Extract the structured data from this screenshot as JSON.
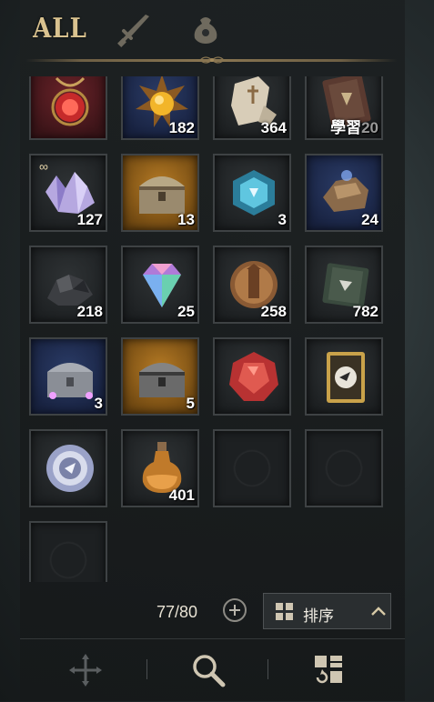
{
  "tabs": [
    {
      "label": "ALL",
      "selected": true
    },
    {
      "icon": "sword-icon",
      "selected": false
    },
    {
      "icon": "pouch-icon",
      "selected": false
    }
  ],
  "slots": [
    {
      "name": "red-amulet",
      "bg": "red",
      "count": ""
    },
    {
      "name": "sun-gem-medallion",
      "bg": "blue",
      "count": "182"
    },
    {
      "name": "ancient-scroll-fragments",
      "bg": "dark",
      "count": "364"
    },
    {
      "name": "skill-book",
      "bg": "dark",
      "count": "20",
      "prefix": "學習"
    },
    {
      "name": "crystal-shards",
      "bg": "dark",
      "count": "127",
      "badge": "∞"
    },
    {
      "name": "ornate-treasure-chest",
      "bg": "orange",
      "count": "13"
    },
    {
      "name": "blue-crystal-box",
      "bg": "dark",
      "count": "3"
    },
    {
      "name": "glowing-gauntlet-armor",
      "bg": "blue",
      "count": "24"
    },
    {
      "name": "black-ore",
      "bg": "dark",
      "count": "218"
    },
    {
      "name": "rainbow-diamond",
      "bg": "dark",
      "count": "25"
    },
    {
      "name": "tower-coin",
      "bg": "dark",
      "count": "258"
    },
    {
      "name": "rune-book",
      "bg": "dark",
      "count": "782"
    },
    {
      "name": "silver-chest-with-sparkles",
      "bg": "blue",
      "count": "3"
    },
    {
      "name": "dark-treasure-chest",
      "bg": "orange",
      "count": "5"
    },
    {
      "name": "red-ruby",
      "bg": "dark",
      "count": ""
    },
    {
      "name": "golden-card",
      "bg": "dark",
      "count": ""
    },
    {
      "name": "silver-disc-token",
      "bg": "dark",
      "count": ""
    },
    {
      "name": "potion-flask",
      "bg": "dark",
      "count": "401"
    },
    {
      "name": "empty",
      "bg": "empty",
      "count": ""
    },
    {
      "name": "empty",
      "bg": "empty",
      "count": ""
    },
    {
      "name": "empty",
      "bg": "empty",
      "count": ""
    }
  ],
  "inventory": {
    "capacity": "77/80"
  },
  "sort": {
    "label": "排序"
  },
  "footer": {
    "buttons": [
      "move-arrows-icon",
      "magnifier-icon",
      "sort-grid-icon"
    ]
  }
}
